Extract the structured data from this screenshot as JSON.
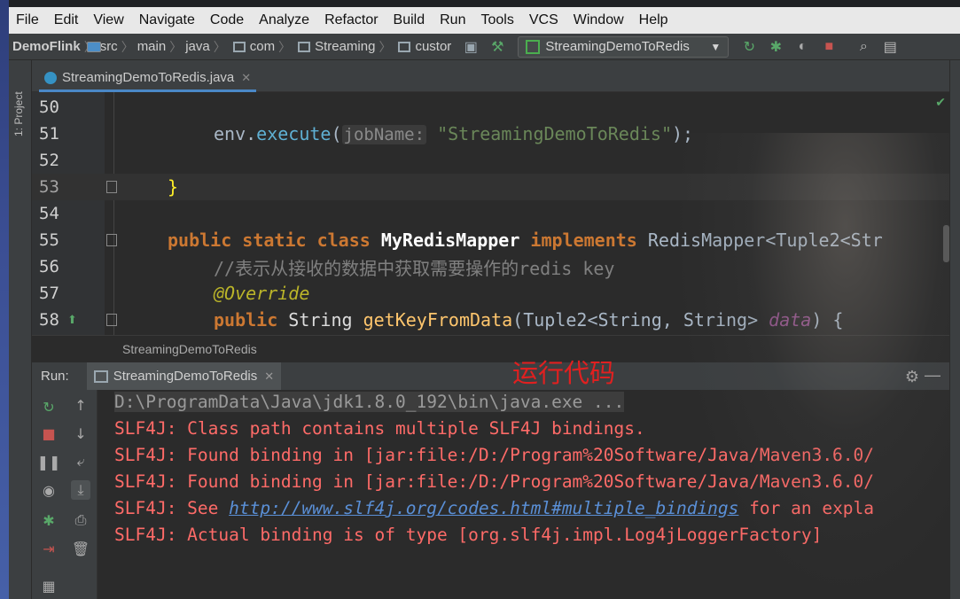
{
  "menu": [
    "File",
    "Edit",
    "View",
    "Navigate",
    "Code",
    "Analyze",
    "Refactor",
    "Build",
    "Run",
    "Tools",
    "VCS",
    "Window",
    "Help"
  ],
  "nav": {
    "crumbs": [
      "DemoFlink",
      "src",
      "main",
      "java",
      "com",
      "Streaming",
      "custor"
    ],
    "run_config": "StreamingDemoToRedis"
  },
  "side": {
    "project_label": "1: Project"
  },
  "editor": {
    "tab": "StreamingDemoToRedis.java",
    "lines": [
      {
        "n": "50"
      },
      {
        "n": "51"
      },
      {
        "n": "52"
      },
      {
        "n": "53"
      },
      {
        "n": "54"
      },
      {
        "n": "55"
      },
      {
        "n": "56"
      },
      {
        "n": "57"
      },
      {
        "n": "58"
      }
    ],
    "code": {
      "l51_a": "env.",
      "l51_b": "execute",
      "l51_c": "(",
      "l51_hint": "jobName:",
      "l51_str": "\"StreamingDemoToRedis\"",
      "l51_end": ");",
      "l53": "}",
      "l55_kw": "public static class",
      "l55_name": "MyRedisMapper",
      "l55_impl": "implements",
      "l55_rest": "RedisMapper<Tuple2<Str",
      "l56": "//表示从接收的数据中获取需要操作的redis key",
      "l57": "@Override",
      "l58_kw": "public",
      "l58_type": "String",
      "l58_fn": "getKeyFromData",
      "l58_p1": "(Tuple2<String, String>",
      "l58_par": "data",
      "l58_end": ") {"
    },
    "breadcrumb": "StreamingDemoToRedis"
  },
  "run": {
    "label": "Run:",
    "tab": "StreamingDemoToRedis",
    "overlay": "运行代码",
    "console": [
      "D:\\ProgramData\\Java\\jdk1.8.0_192\\bin\\java.exe ...",
      "SLF4J: Class path contains multiple SLF4J bindings.",
      "SLF4J: Found binding in [jar:file:/D:/Program%20Software/Java/Maven3.6.0/",
      "SLF4J: Found binding in [jar:file:/D:/Program%20Software/Java/Maven3.6.0/",
      "SLF4J: See ",
      "http://www.slf4j.org/codes.html#multiple_bindings",
      " for an expla",
      "SLF4J: Actual binding is of type [org.slf4j.impl.Log4jLoggerFactory]"
    ]
  },
  "colors": {
    "accent": "#4a88c7",
    "error_text": "#ff6b68",
    "overlay_red": "#e02020"
  }
}
